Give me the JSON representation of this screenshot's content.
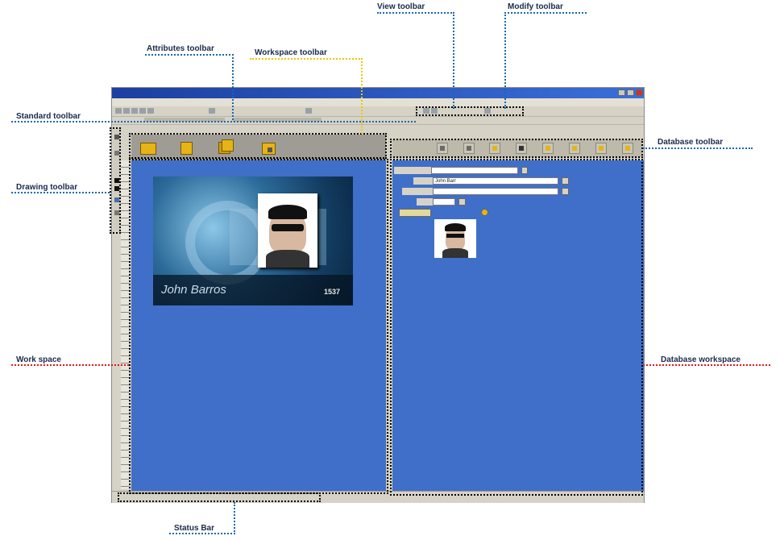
{
  "callouts": {
    "view_toolbar": "View toolbar",
    "modify_toolbar": "Modify toolbar",
    "attributes_toolbar": "Attributes toolbar",
    "workspace_toolbar": "Workspace toolbar",
    "standard_toolbar": "Standard toolbar",
    "database_toolbar": "Database toolbar",
    "drawing_toolbar": "Drawing toolbar",
    "work_space": "Work space",
    "database_workspace": "Database workspace",
    "status_bar": "Status Bar"
  },
  "card": {
    "name": "John Barros",
    "code": "1537"
  },
  "database": {
    "name_value": "John Barr"
  },
  "colors": {
    "workspace_blue": "#3f6fc9",
    "callout_blue": "#1a67b0",
    "callout_red": "#e01818",
    "callout_yellow": "#e8c800",
    "title_bar": "#1c3fa0"
  }
}
